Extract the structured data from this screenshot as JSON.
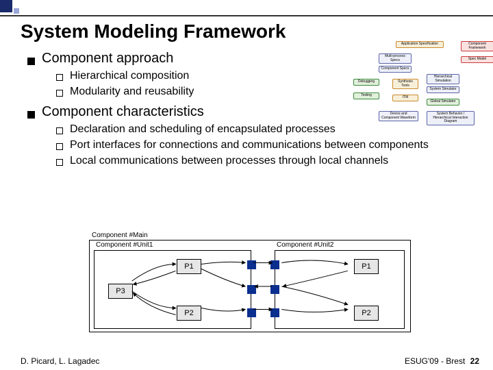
{
  "title": "System Modeling Framework",
  "bullets": [
    {
      "text": "Component approach",
      "sub": [
        "Hierarchical composition",
        "Modularity and reusability"
      ]
    },
    {
      "text": "Component characteristics",
      "sub": [
        "Declaration and scheduling of encapsulated processes",
        "Port interfaces for connections and communications between components",
        "Local communications between processes through local channels"
      ]
    }
  ],
  "component_diagram": {
    "main_label": "Component #Main",
    "unit1_label": "Component #Unit1",
    "unit2_label": "Component #Unit2",
    "p1": "P1",
    "p2": "P2",
    "p3": "P3"
  },
  "side_diagram": {
    "top": "Application Specification",
    "left_col": [
      "Multi-process Specs",
      "Component Specs"
    ],
    "left_side": [
      "Debugging",
      "Testing"
    ],
    "center": [
      "Synthesis Tools",
      "ITM"
    ],
    "right_col": [
      "Hierarchical Simulation",
      "System Simulator"
    ],
    "right_red": [
      "Component Framework",
      "Spec Model"
    ],
    "bottom_left": "Device and Component Waveform",
    "bottom_right": "System Behavior / Hierarchical Interaction Diagram",
    "global_sim": "Global Simulator"
  },
  "footer": {
    "left": "D. Picard, L. Lagadec",
    "right": "ESUG'09 - Brest",
    "page": "22"
  }
}
